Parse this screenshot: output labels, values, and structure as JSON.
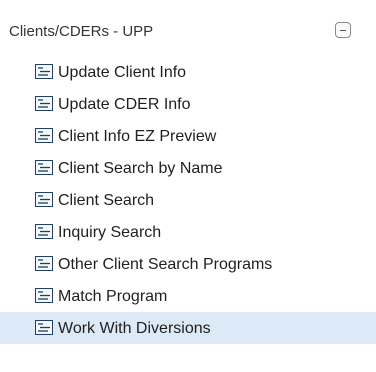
{
  "panel": {
    "title": "Clients/CDERs - UPP",
    "collapse_icon": "minus-icon"
  },
  "menu": {
    "item_icon": "list-document-icon",
    "selected_color": "#dce9f7",
    "items": [
      {
        "label": "Update Client Info"
      },
      {
        "label": "Update CDER Info"
      },
      {
        "label": "Client Info EZ Preview"
      },
      {
        "label": "Client Search by Name"
      },
      {
        "label": "Client Search"
      },
      {
        "label": "Inquiry Search"
      },
      {
        "label": "Other Client Search Programs"
      },
      {
        "label": "Match Program"
      },
      {
        "label": "Work With Diversions",
        "selected": true
      }
    ]
  }
}
